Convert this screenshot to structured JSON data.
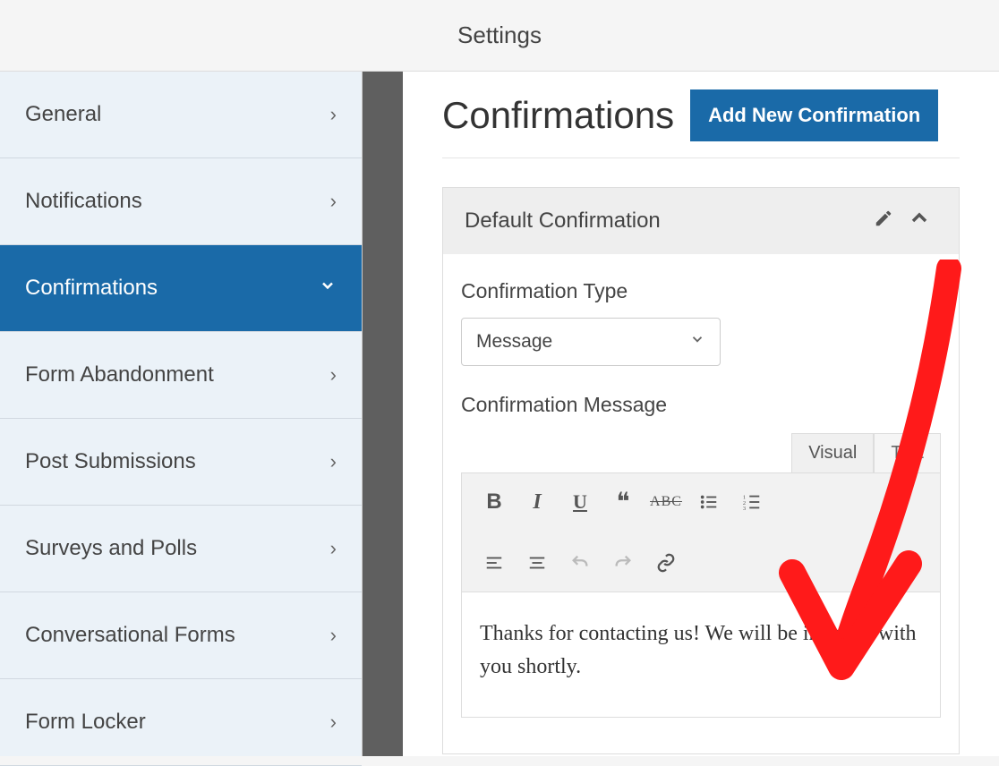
{
  "header": {
    "title": "Settings"
  },
  "sidebar": {
    "items": [
      {
        "label": "General",
        "active": false
      },
      {
        "label": "Notifications",
        "active": false
      },
      {
        "label": "Confirmations",
        "active": true
      },
      {
        "label": "Form Abandonment",
        "active": false
      },
      {
        "label": "Post Submissions",
        "active": false
      },
      {
        "label": "Surveys and Polls",
        "active": false
      },
      {
        "label": "Conversational Forms",
        "active": false
      },
      {
        "label": "Form Locker",
        "active": false
      }
    ]
  },
  "main": {
    "page_title": "Confirmations",
    "add_button": "Add New Confirmation",
    "panel": {
      "title": "Default Confirmation",
      "type_label": "Confirmation Type",
      "type_value": "Message",
      "message_label": "Confirmation Message",
      "tabs": {
        "visual": "Visual",
        "text": "Text"
      },
      "toolbar": {
        "bold": "B",
        "italic": "I",
        "underline": "U",
        "quote": "❝",
        "strike": "ABC",
        "ul": "list-ul",
        "ol": "list-ol",
        "align_left": "align-left",
        "align_center": "align-center",
        "undo": "undo",
        "redo": "redo",
        "link": "link"
      },
      "message_body": "Thanks for contacting us! We will be in touch with you shortly."
    }
  },
  "colors": {
    "accent": "#1a6aa8",
    "sidebar_bg": "#ebf2f8",
    "annotation": "#ff0000"
  }
}
